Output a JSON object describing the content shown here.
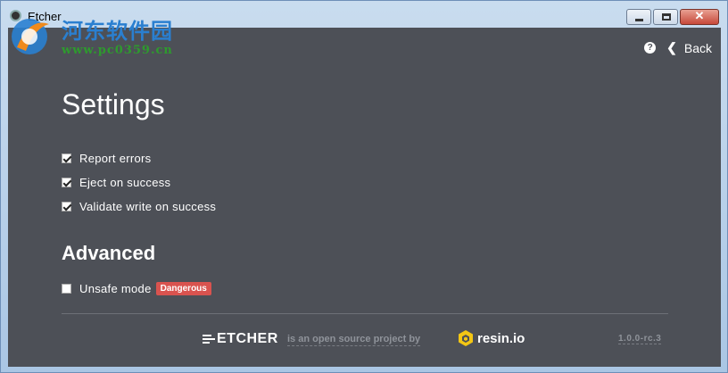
{
  "window": {
    "title": "Etcher",
    "close_symbol": "✕"
  },
  "watermark": {
    "site_name": "河东软件园",
    "url": "www.pc0359.cn"
  },
  "topbar": {
    "help_icon": "question-circle-icon",
    "help_symbol": "?",
    "back_label": "Back",
    "back_icon": "chevron-left-icon",
    "back_symbol": "❮"
  },
  "settings": {
    "title": "Settings",
    "options": [
      {
        "label": "Report errors",
        "checked": true
      },
      {
        "label": "Eject on success",
        "checked": true
      },
      {
        "label": "Validate write on success",
        "checked": true
      }
    ]
  },
  "advanced": {
    "title": "Advanced",
    "options": [
      {
        "label": "Unsafe mode",
        "checked": false,
        "badge": "Dangerous"
      }
    ]
  },
  "footer": {
    "product": "ETCHER",
    "tagline": "is an open source project by",
    "company": "resin.io",
    "version": "1.0.0-rc.3"
  },
  "colors": {
    "background": "#4d5057",
    "danger": "#d9534f",
    "resin_yellow": "#f3c614"
  }
}
